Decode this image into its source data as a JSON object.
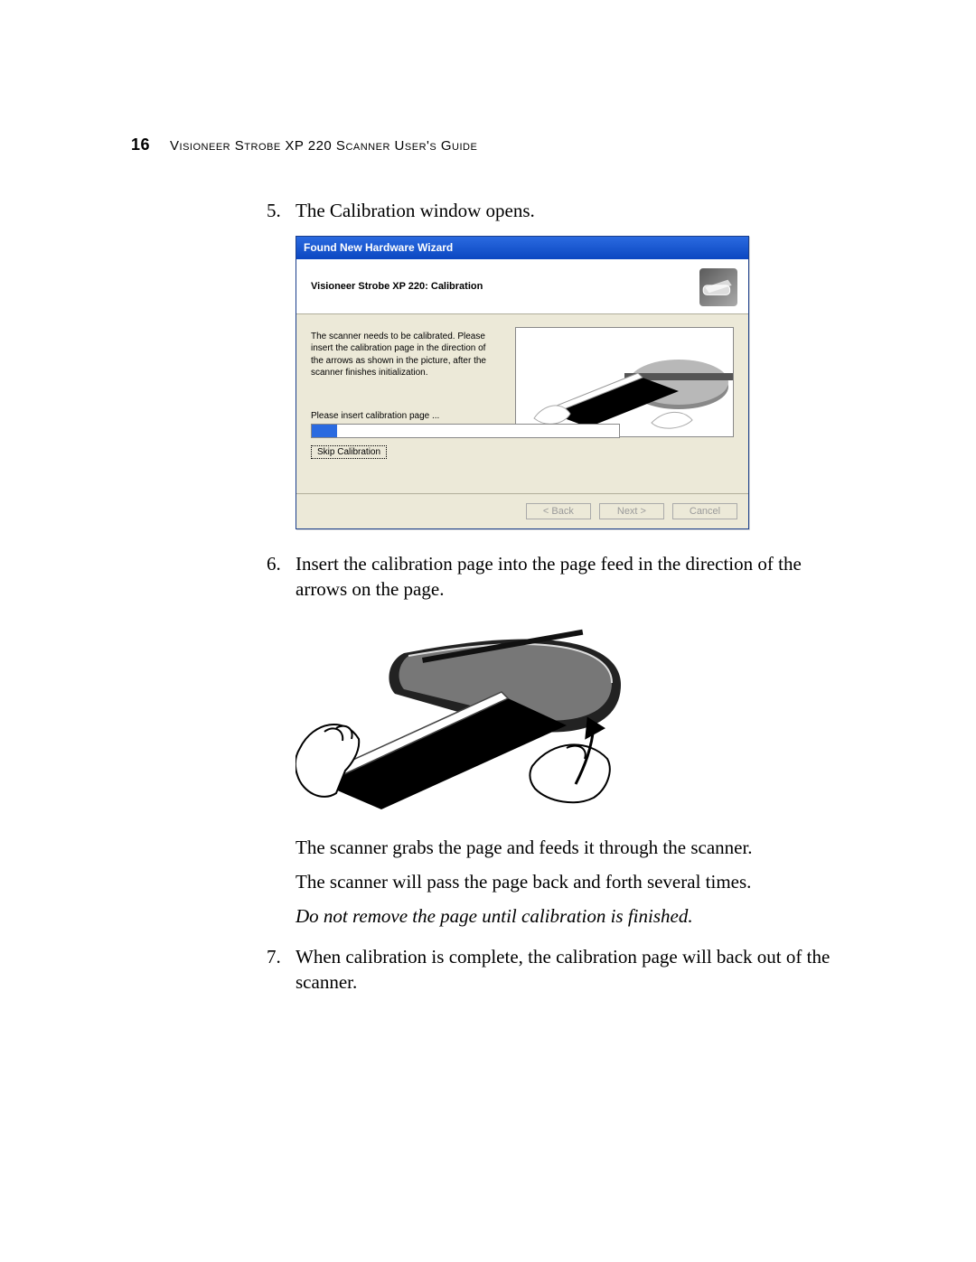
{
  "header": {
    "page_number": "16",
    "title": "Visioneer Strobe XP 220 Scanner User's Guide"
  },
  "steps": {
    "s5": {
      "num": "5.",
      "text": "The Calibration window opens."
    },
    "s6": {
      "num": "6.",
      "text": "Insert the calibration page into the page feed in the direction of the arrows on the page.",
      "p1": "The scanner grabs the page and feeds it through the scanner.",
      "p2": "The scanner will pass the page back and forth several times.",
      "p3": "Do not remove the page until calibration is finished."
    },
    "s7": {
      "num": "7.",
      "text": "When calibration is complete, the calibration page will back out of the scanner."
    }
  },
  "wizard": {
    "titlebar": "Found New Hardware Wizard",
    "header_title": "Visioneer Strobe XP 220: Calibration",
    "instructions": "The scanner needs to be calibrated. Please insert the calibration page in the direction of the arrows as shown in the picture, after the scanner finishes initialization.",
    "progress_label": "Please insert calibration page ...",
    "skip_label": "Skip Calibration",
    "back_label": "< Back",
    "next_label": "Next >",
    "cancel_label": "Cancel"
  }
}
